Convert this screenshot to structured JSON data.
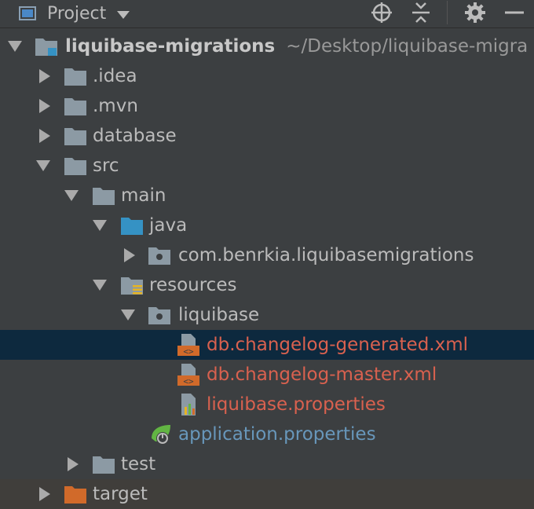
{
  "toolbar": {
    "title": "Project",
    "icons": [
      "window-icon",
      "dropdown-caret-icon",
      "locate-icon",
      "collapse-all-icon",
      "gear-icon",
      "minimize-icon"
    ]
  },
  "tree": {
    "root_name": "liquibase-migrations",
    "root_path": "~/Desktop/liquibase-migra",
    "items": [
      {
        "label": "liquibase-migrations"
      },
      {
        "label": ".idea"
      },
      {
        "label": ".mvn"
      },
      {
        "label": "database"
      },
      {
        "label": "src"
      },
      {
        "label": "main"
      },
      {
        "label": "java"
      },
      {
        "label": "com.benrkia.liquibasemigrations"
      },
      {
        "label": "resources"
      },
      {
        "label": "liquibase"
      },
      {
        "label": "db.changelog-generated.xml"
      },
      {
        "label": "db.changelog-master.xml"
      },
      {
        "label": "liquibase.properties"
      },
      {
        "label": "application.properties"
      },
      {
        "label": "test"
      },
      {
        "label": "target"
      }
    ]
  },
  "colors": {
    "background": "#3c3f41",
    "selection": "#0d293e",
    "modified_file": "#d9614f",
    "spring_file": "#6897bb",
    "folder": "#8c9aa4",
    "source_folder": "#3592c4",
    "excluded_folder": "#d16a2a"
  }
}
